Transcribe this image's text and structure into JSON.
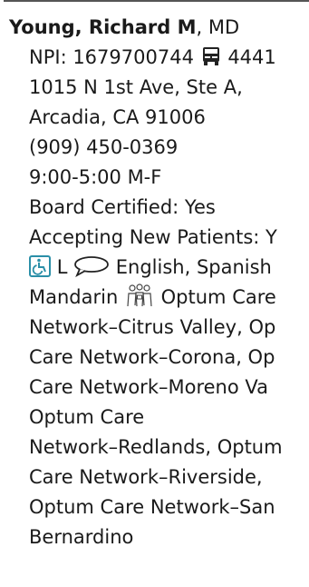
{
  "provider": {
    "name": "Young, Richard M",
    "credential": ", MD",
    "npi": "NPI: 1679700744",
    "icons": {
      "transit": "bus-icon",
      "accessibility": "wheelchair-icon",
      "language": "speech-bubble-icon",
      "medical_group": "medical-group-icon"
    },
    "transit_code": "4441",
    "address_line1": "1015 N 1st Ave, Ste A,",
    "address_line2": "Arcadia, CA 91006",
    "phone": "(909) 450-0369",
    "hours": "9:00-5:00 M-F",
    "board_certified": "Board Certified: Yes",
    "accepting_new_patients": "Accepting New Patients: Y",
    "accessibility_code": "L",
    "languages": "English, Spanish",
    "language_cont": "Mandarin",
    "networks_line1": "Optum Care",
    "networks_line2": "Network–Citrus Valley, Op",
    "networks_line3": "Care Network–Corona, Op",
    "networks_line4": "Care Network–Moreno Va",
    "networks_line5": "Optum Care",
    "networks_line6": "Network–Redlands, Optum",
    "networks_line7": "Care Network–Riverside,",
    "networks_line8": "Optum Care Network–San",
    "networks_line9": "Bernardino"
  },
  "colors": {
    "accessibility_icon": "#2b8fa8",
    "text": "#1a1a1a"
  }
}
